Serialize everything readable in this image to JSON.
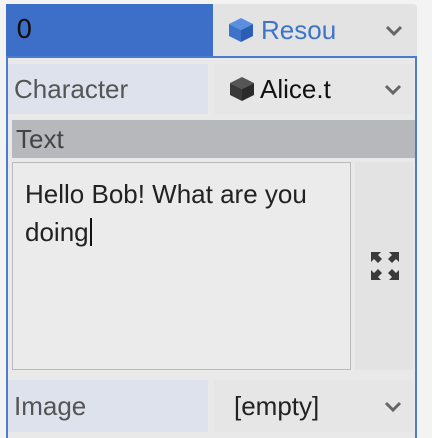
{
  "top": {
    "index_value": "0",
    "resource_label": "Resou",
    "resource_icon": "cube-icon"
  },
  "properties": {
    "character": {
      "label": "Character",
      "value": "Alice.t",
      "icon": "cube-icon"
    },
    "text": {
      "label": "Text",
      "value": "Hello Bob! What are you doing",
      "expand_icon": "expand-icon"
    },
    "image": {
      "label": "Image",
      "value": "[empty]"
    }
  },
  "colors": {
    "selected_bg": "#3e6fc8",
    "accent_text": "#3d74c9",
    "panel_border": "#4b7cd0"
  }
}
